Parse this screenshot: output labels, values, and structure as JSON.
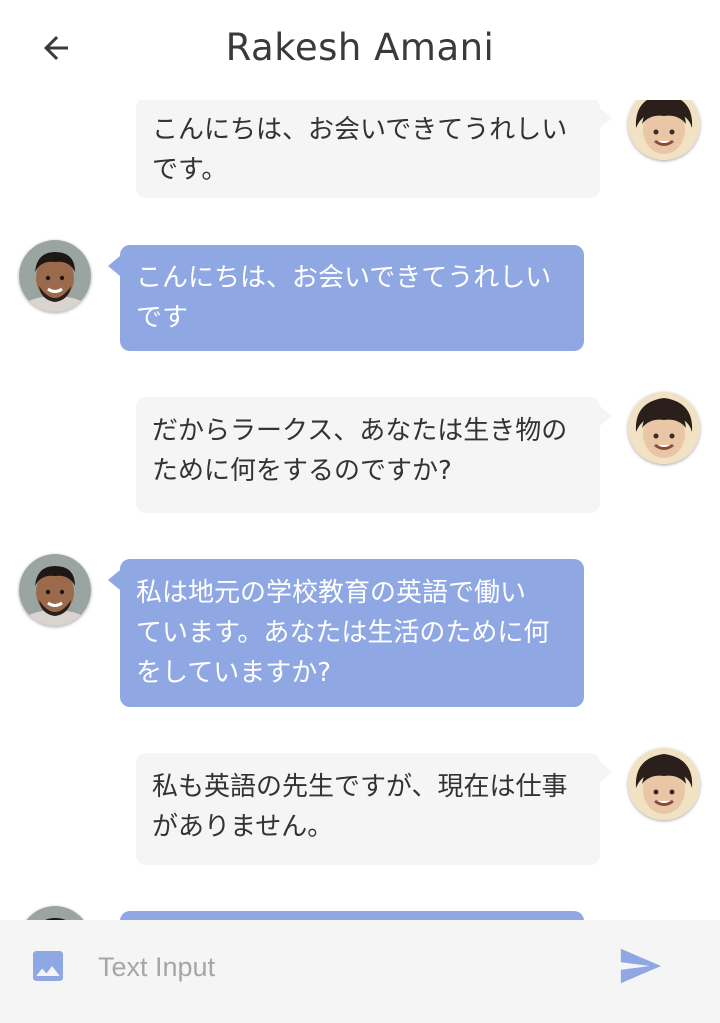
{
  "header": {
    "title": "Rakesh Amani",
    "back_icon": "arrow-back-icon"
  },
  "messages": [
    {
      "sender": "me",
      "text": "こんにちは、お会いできてうれしい\nです。"
    },
    {
      "sender": "them",
      "text": "こんにちは、お会いできてうれしい\nです"
    },
    {
      "sender": "me",
      "text": "だからラークス、あなたは生き物の\nために何をするのですか?"
    },
    {
      "sender": "them",
      "text": "私は地元の学校教育の英語で働い\nています。あなたは生活のために何\nをしていますか?"
    },
    {
      "sender": "me",
      "text": "私も英語の先生ですが、現在は仕事\nがありません。"
    },
    {
      "sender": "them",
      "text": ""
    }
  ],
  "composer": {
    "placeholder": "Text Input",
    "image_icon": "image-icon",
    "send_icon": "send-icon"
  },
  "colors": {
    "my_bubble": "#f5f5f5",
    "their_bubble": "#8fa8e4",
    "accent": "#8fa8e4"
  }
}
